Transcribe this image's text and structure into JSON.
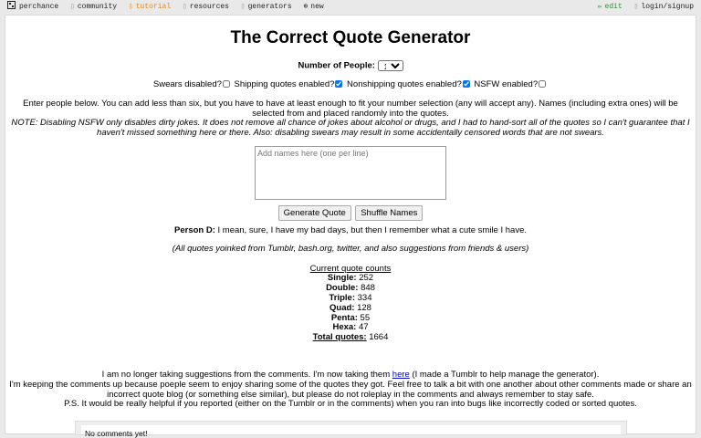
{
  "nav": {
    "site": "perchance",
    "community": "community",
    "tutorial": "tutorial",
    "resources": "resources",
    "generators": "generators",
    "new": "new",
    "edit": "edit",
    "login": "login/signup"
  },
  "page": {
    "title": "The Correct Quote Generator",
    "people_label": "Number of People:",
    "people_value": "1",
    "swears_label": "Swears disabled?",
    "shipping_label": "Shipping quotes enabled?",
    "nonshipping_label": "Nonshipping quotes enabled?",
    "nsfw_label": "NSFW enabled?",
    "instructions_1": "Enter people below. You can add less than six, but you have to have at least enough to fit your number selection (any will accept any). Names (including extra ones) will be",
    "instructions_2": "selected from and placed randomly into the quotes.",
    "note_1": "NOTE: Disabling NSFW only disables dirty jokes. It does not remove all chance of jokes about alcohol or drugs, and I had to hand-sort all of the quotes so I can't guarantee that I",
    "note_2": "haven't missed something here or there. Also: disabling swears may result in some accidentally censored words that are not swears.",
    "names_placeholder": "Add names here (one per line)",
    "generate_btn": "Generate Quote",
    "shuffle_btn": "Shuffle Names",
    "quote_speaker": "Person D:",
    "quote_text": "I mean, sure, I have my bad days, but then I remember what a cute smile I have.",
    "sources": "(All quotes yoinked from Tumblr, bash.org, twitter, and also suggestions from friends & users)",
    "counts_title": "Current quote counts",
    "counts": [
      {
        "label": "Single:",
        "value": "252"
      },
      {
        "label": "Double:",
        "value": "848"
      },
      {
        "label": "Triple:",
        "value": "334"
      },
      {
        "label": "Quad:",
        "value": "128"
      },
      {
        "label": "Penta:",
        "value": "55"
      },
      {
        "label": "Hexa:",
        "value": "47"
      }
    ],
    "total_label": "Total quotes:",
    "total_value": "1664",
    "footer_1a": "I am no longer taking suggestions from the comments. I'm now taking them",
    "footer_1_link": "here",
    "footer_1b": "(I made a Tumblr to help manage the generator).",
    "footer_2": "I'm keeping the comments up because poeple seem to enjoy sharing some of the quotes they got. Feel free to talk a bit with one another about other comments made or share an",
    "footer_3": "incorrect quote blog (or something else similar), but please do not roleplay in the comments and always remember to stay safe.",
    "footer_4": "P.S. It would be really helpful if you reported (either on the Tumblr or in the comments) when you ran into bugs like incorrectly coded or sorted quotes.",
    "no_comments": "No comments yet!"
  },
  "colors": {
    "tutorial": "#e6881e",
    "edit": "#3a8a3a",
    "link": "#0000cc"
  }
}
